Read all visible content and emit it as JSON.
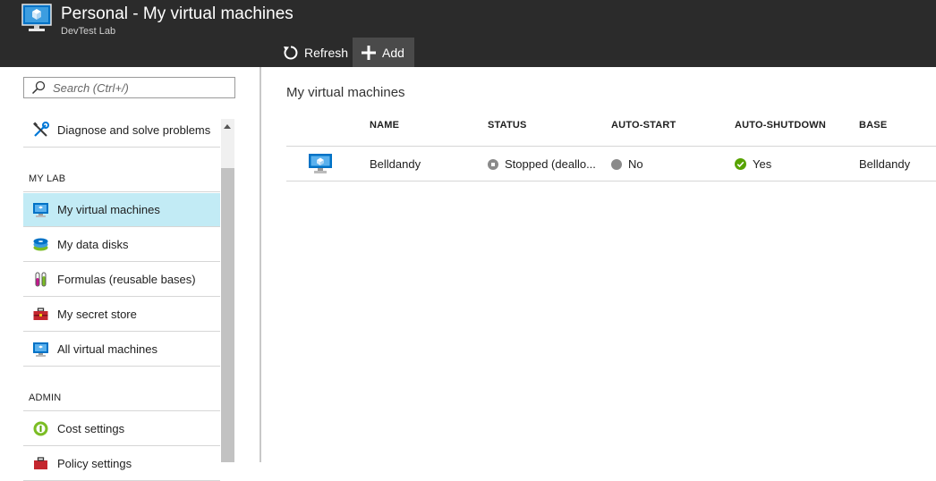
{
  "header": {
    "title": "Personal - My virtual machines",
    "subtitle": "DevTest Lab",
    "icon": "vm-monitor-icon"
  },
  "toolbar": {
    "refresh_label": "Refresh",
    "add_label": "Add"
  },
  "search": {
    "placeholder": "Search (Ctrl+/)"
  },
  "sidebar": {
    "top_items": [
      {
        "label": "Diagnose and solve problems",
        "icon": "wrench-icon"
      }
    ],
    "sections": [
      {
        "label": "MY LAB",
        "items": [
          {
            "label": "My virtual machines",
            "icon": "vm-monitor-icon",
            "active": true
          },
          {
            "label": "My data disks",
            "icon": "data-disk-icon"
          },
          {
            "label": "Formulas (reusable bases)",
            "icon": "test-tubes-icon"
          },
          {
            "label": "My secret store",
            "icon": "toolbox-icon"
          },
          {
            "label": "All virtual machines",
            "icon": "vm-monitor-icon"
          }
        ]
      },
      {
        "label": "ADMIN",
        "items": [
          {
            "label": "Cost settings",
            "icon": "cost-coin-icon"
          },
          {
            "label": "Policy settings",
            "icon": "policy-icon"
          }
        ]
      }
    ]
  },
  "main": {
    "title": "My virtual machines",
    "columns": [
      "NAME",
      "STATUS",
      "AUTO-START",
      "AUTO-SHUTDOWN",
      "BASE"
    ],
    "rows": [
      {
        "icon": "vm-monitor-icon",
        "name": "Belldandy",
        "status": "Stopped (deallo...",
        "auto_start": "No",
        "auto_shutdown": "Yes",
        "base": "Belldandy"
      }
    ]
  },
  "colors": {
    "header_bg": "#2b2b2b",
    "active_item_bg": "#c2ebf5",
    "yes_green": "#57a300",
    "no_gray": "#8a8a8a",
    "vm_blue": "#0072c6"
  }
}
